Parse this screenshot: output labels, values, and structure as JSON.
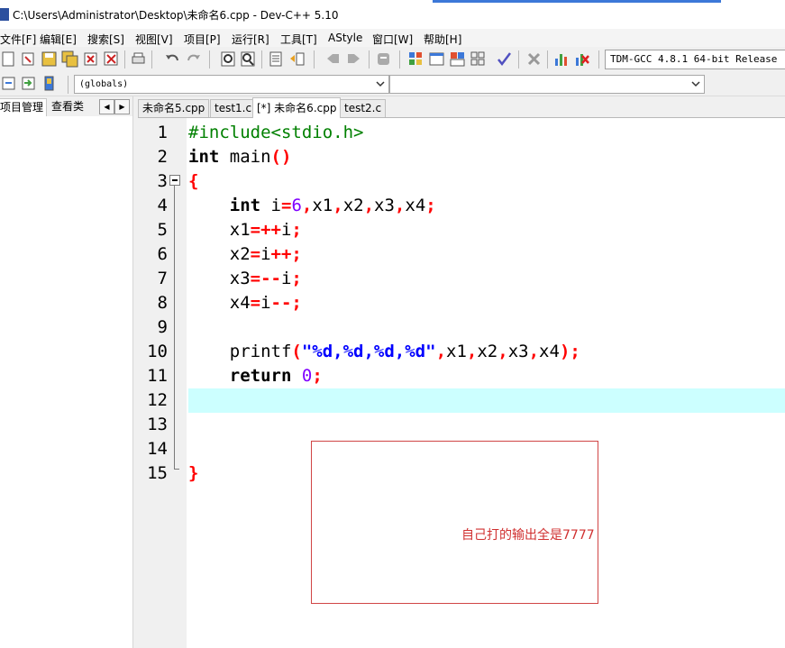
{
  "window": {
    "title": "C:\\Users\\Administrator\\Desktop\\未命名6.cpp - Dev-C++ 5.10"
  },
  "menu": {
    "items": [
      "文件[F]",
      "编辑[E]",
      "搜索[S]",
      "视图[V]",
      "项目[P]",
      "运行[R]",
      "工具[T]",
      "AStyle",
      "窗口[W]",
      "帮助[H]"
    ]
  },
  "toolbar": {
    "compiler": "TDM-GCC 4.8.1 64-bit Release"
  },
  "toolbar2": {
    "scope_combo": "(globals)",
    "function_combo": ""
  },
  "left_panel": {
    "tabs": [
      "项目管理",
      "查看类"
    ]
  },
  "editor_tabs": [
    "未命名5.cpp",
    "test1.c",
    "[*] 未命名6.cpp",
    "test2.c"
  ],
  "editor": {
    "line_numbers": [
      "1",
      "2",
      "3",
      "4",
      "5",
      "6",
      "7",
      "8",
      "9",
      "10",
      "11",
      "12",
      "13",
      "14",
      "15"
    ],
    "current_line": "12",
    "code": [
      {
        "line": "1",
        "tokens": [
          {
            "t": "#include<stdio.h>",
            "c": "pp"
          }
        ]
      },
      {
        "line": "2",
        "tokens": [
          {
            "t": "int",
            "c": "kw"
          },
          {
            "t": " main",
            "c": "id"
          },
          {
            "t": "()",
            "c": "sy"
          }
        ]
      },
      {
        "line": "3",
        "tokens": [
          {
            "t": "{",
            "c": "sy"
          }
        ]
      },
      {
        "line": "4",
        "tokens": [
          {
            "t": "    ",
            "c": "id"
          },
          {
            "t": "int",
            "c": "kw"
          },
          {
            "t": " i",
            "c": "id"
          },
          {
            "t": "=",
            "c": "sy"
          },
          {
            "t": "6",
            "c": "num"
          },
          {
            "t": ",",
            "c": "sy"
          },
          {
            "t": "x1",
            "c": "id"
          },
          {
            "t": ",",
            "c": "sy"
          },
          {
            "t": "x2",
            "c": "id"
          },
          {
            "t": ",",
            "c": "sy"
          },
          {
            "t": "x3",
            "c": "id"
          },
          {
            "t": ",",
            "c": "sy"
          },
          {
            "t": "x4",
            "c": "id"
          },
          {
            "t": ";",
            "c": "sy"
          }
        ]
      },
      {
        "line": "5",
        "tokens": [
          {
            "t": "    x1",
            "c": "id"
          },
          {
            "t": "=++",
            "c": "sy"
          },
          {
            "t": "i",
            "c": "id"
          },
          {
            "t": ";",
            "c": "sy"
          }
        ]
      },
      {
        "line": "6",
        "tokens": [
          {
            "t": "    x2",
            "c": "id"
          },
          {
            "t": "=",
            "c": "sy"
          },
          {
            "t": "i",
            "c": "id"
          },
          {
            "t": "++;",
            "c": "sy"
          }
        ]
      },
      {
        "line": "7",
        "tokens": [
          {
            "t": "    x3",
            "c": "id"
          },
          {
            "t": "=--",
            "c": "sy"
          },
          {
            "t": "i",
            "c": "id"
          },
          {
            "t": ";",
            "c": "sy"
          }
        ]
      },
      {
        "line": "8",
        "tokens": [
          {
            "t": "    x4",
            "c": "id"
          },
          {
            "t": "=",
            "c": "sy"
          },
          {
            "t": "i",
            "c": "id"
          },
          {
            "t": "--;",
            "c": "sy"
          }
        ]
      },
      {
        "line": "9",
        "tokens": []
      },
      {
        "line": "10",
        "tokens": [
          {
            "t": "    printf",
            "c": "id"
          },
          {
            "t": "(",
            "c": "sy"
          },
          {
            "t": "\"%d,%d,%d,%d\"",
            "c": "str"
          },
          {
            "t": ",",
            "c": "sy"
          },
          {
            "t": "x1",
            "c": "id"
          },
          {
            "t": ",",
            "c": "sy"
          },
          {
            "t": "x2",
            "c": "id"
          },
          {
            "t": ",",
            "c": "sy"
          },
          {
            "t": "x3",
            "c": "id"
          },
          {
            "t": ",",
            "c": "sy"
          },
          {
            "t": "x4",
            "c": "id"
          },
          {
            "t": ");",
            "c": "sy"
          }
        ]
      },
      {
        "line": "11",
        "tokens": [
          {
            "t": "    ",
            "c": "id"
          },
          {
            "t": "return",
            "c": "kw"
          },
          {
            "t": " ",
            "c": "id"
          },
          {
            "t": "0",
            "c": "num"
          },
          {
            "t": ";",
            "c": "sy"
          }
        ]
      },
      {
        "line": "12",
        "tokens": []
      },
      {
        "line": "13",
        "tokens": []
      },
      {
        "line": "14",
        "tokens": []
      },
      {
        "line": "15",
        "tokens": [
          {
            "t": "}",
            "c": "sy"
          }
        ]
      }
    ]
  },
  "annotation": {
    "text": "自己打的输出全是7777",
    "color": "#d03030"
  },
  "colors": {
    "current_line": "#ccffff",
    "preprocessor": "#008000",
    "symbol": "#ff0000",
    "number": "#8000ff",
    "string": "#0000ff"
  }
}
